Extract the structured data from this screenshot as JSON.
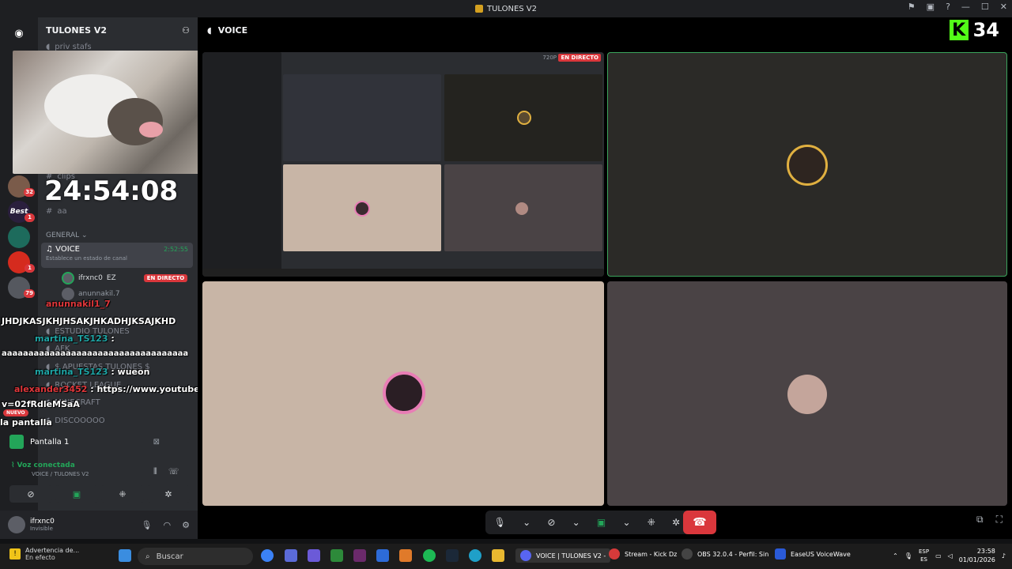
{
  "window": {
    "title": "TULONES V2"
  },
  "server_rail": {
    "badges": [
      "32",
      "1",
      "1",
      "79"
    ],
    "best_label": "Best"
  },
  "sidebar": {
    "server_name": "TULONES V2",
    "channels_top": [
      {
        "icon": "speaker-icon",
        "name": "priv stafs"
      },
      {
        "icon": "hash-icon",
        "name": "clips"
      },
      {
        "icon": "hash-icon",
        "name": "aa"
      }
    ],
    "category": "GENERAL",
    "active_voice": {
      "name": "VOICE",
      "time": "2:52:55",
      "status_prompt": "Establece un estado de canal"
    },
    "voice_users": [
      {
        "name": "ifrxnc0",
        "tag": "EZ",
        "live": "EN DIRECTO"
      },
      {
        "name": "anunnakil.7",
        "live": ""
      }
    ],
    "channels_bottom": [
      "ESTUDIO TULONES",
      "AFK",
      "$ APUESTAS TULONES $",
      "ROCKET LEAGUE",
      "MINECRAFT",
      "DISCOOOOO"
    ]
  },
  "overlay": {
    "clock": "24:54:08",
    "chat": [
      {
        "user": "anunnakil1_7",
        "text": ""
      },
      {
        "user": "",
        "text": "JHDJKASJKHJHSAKJHKADHJKSAJKHD"
      },
      {
        "user": "martina_TS123",
        "text": ":"
      },
      {
        "user": "",
        "text": "aaaaaaaaaaaaaaaaaaaaaaaaaaaaaaaaaaa"
      },
      {
        "user": "martina_TS123",
        "text": ": wueon"
      },
      {
        "user": "alexander3452",
        "text": ": https://www.youtube.com/watch?"
      },
      {
        "user": "",
        "text": "v=02fRdleMSaA"
      },
      {
        "user": "",
        "text": "la pantalla"
      }
    ],
    "nuevo_badge": "NUEVO"
  },
  "panel": {
    "screen_share": "Pantalla 1",
    "voice_status": "Voz conectada",
    "voice_location": "VOICE / TULONES V2"
  },
  "user": {
    "name": "ifrxnc0",
    "status": "Invisible"
  },
  "main": {
    "channel": "VOICE",
    "kick_count": "34",
    "live_label": "EN DIRECTO",
    "quality": "720P"
  },
  "taskbar": {
    "warning_title": "Advertencia de...",
    "warning_sub": "En efecto",
    "search_placeholder": "Buscar",
    "apps": [
      "VOICE | TULONES V2 -",
      "Stream - Kick Dz",
      "OBS 32.0.4 - Perfil: Sin",
      "EaseUS VoiceWave"
    ],
    "lang": [
      "ESP",
      "ES"
    ],
    "time": "23:58",
    "date": "01/01/2026"
  },
  "colors": {
    "accent_green": "#23a559",
    "danger_red": "#da373c",
    "kick_green": "#53fc18"
  }
}
